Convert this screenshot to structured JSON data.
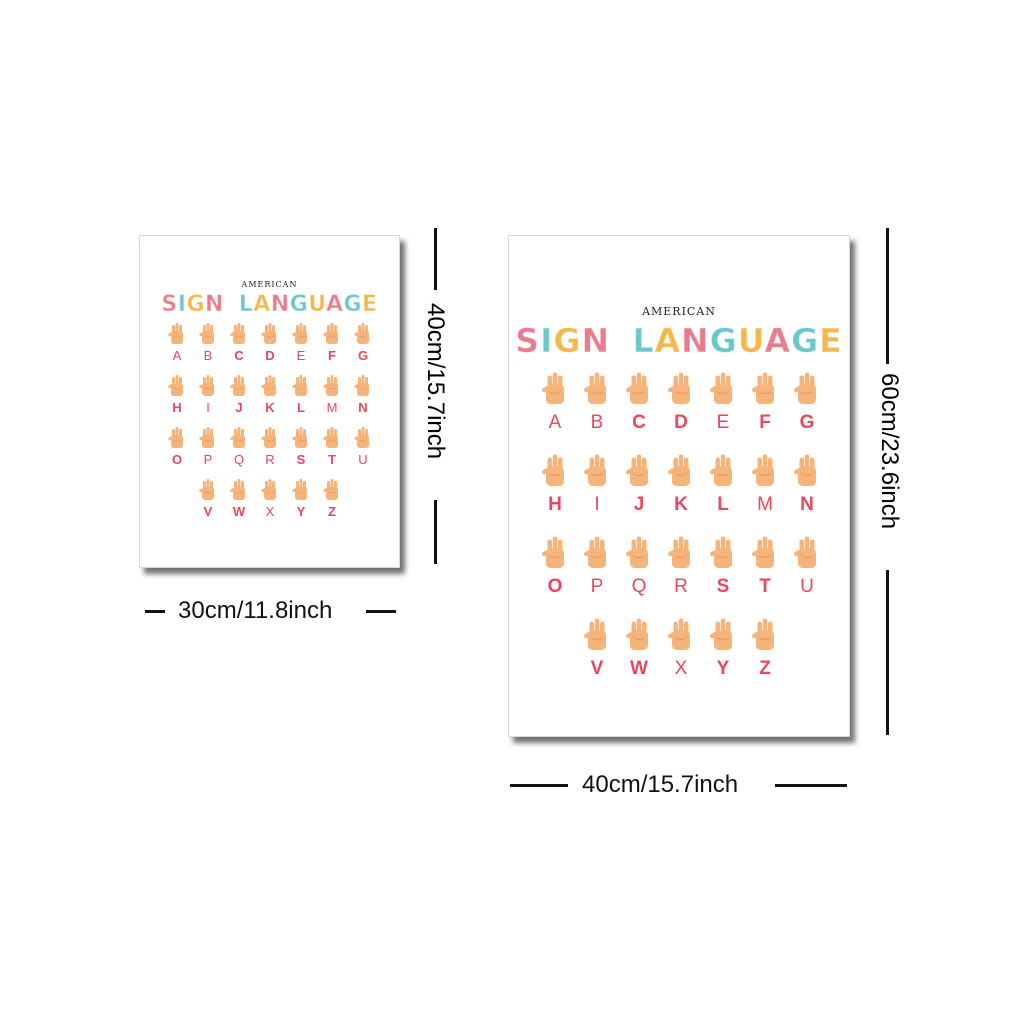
{
  "posters": {
    "small": {
      "subtitle": "AMERICAN",
      "title": [
        "SIGN",
        "LANGUAGE"
      ]
    },
    "large": {
      "subtitle": "AMERICAN",
      "title": [
        "SIGN",
        "LANGUAGE"
      ]
    }
  },
  "title_colors": [
    "#e97b8e",
    "#6cc7c9",
    "#f2b94a",
    "#e97b8e",
    "#6cc7c9",
    "#f2b94a",
    "#e97b8e",
    "#6cc7c9",
    "#f2b94a",
    "#e97b8e",
    "#6cc7c9",
    "#f2b94a"
  ],
  "letter_color": "#e8475e",
  "hand_color": "#f5b47a",
  "rows": [
    [
      "A",
      "B",
      "C",
      "D",
      "E",
      "F",
      "G"
    ],
    [
      "H",
      "I",
      "J",
      "K",
      "L",
      "M",
      "N"
    ],
    [
      "O",
      "P",
      "Q",
      "R",
      "S",
      "T",
      "U"
    ],
    [
      "V",
      "W",
      "X",
      "Y",
      "Z"
    ]
  ],
  "bold_letters": [
    "C",
    "D",
    "F",
    "G",
    "H",
    "J",
    "K",
    "L",
    "N",
    "O",
    "S",
    "T",
    "V",
    "W",
    "Y",
    "Z"
  ],
  "dimensions": {
    "small_width": "30cm/11.8inch",
    "small_height": "40cm/15.7inch",
    "large_width": "40cm/15.7inch",
    "large_height": "60cm/23.6inch"
  }
}
